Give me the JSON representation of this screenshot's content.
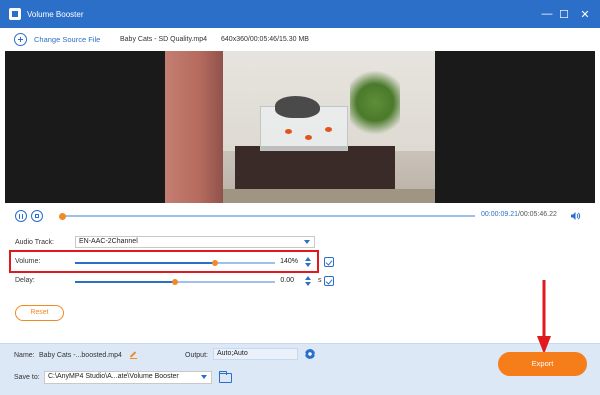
{
  "window": {
    "title": "Volume Booster",
    "minimize_glyph": "—",
    "maximize_glyph": "☐",
    "close_glyph": "✕"
  },
  "topbar": {
    "change_source_label": "Change Source File",
    "file_name": "Baby Cats - SD Quality.mp4",
    "file_meta": "640x360/00:05:46/15.30 MB"
  },
  "player": {
    "current_time": "00:00:09.21",
    "separator": "/",
    "total_time": "00:05:46.22",
    "progress_fraction": 0.0
  },
  "audio": {
    "track_label": "Audio Track:",
    "track_value": "EN-AAC-2Channel",
    "volume_label": "Volume:",
    "volume_value": "140%",
    "volume_fraction": 0.7,
    "delay_label": "Delay:",
    "delay_value": "0.00",
    "delay_unit": "s",
    "delay_fraction": 0.5
  },
  "buttons": {
    "reset": "Reset",
    "export": "Export"
  },
  "output": {
    "name_label": "Name:",
    "name_value": "Baby Cats -...boosted.mp4",
    "output_label": "Output:",
    "output_value": "Auto;Auto",
    "save_label": "Save to:",
    "save_path": "C:\\AnyMP4 Studio\\A...ate\\Volume Booster"
  },
  "colors": {
    "accent": "#2b6fc9",
    "orange": "#f08a24",
    "highlight": "#e0191f"
  },
  "icons": [
    "app-icon",
    "plus-icon",
    "pause-icon",
    "stop-icon",
    "speaker-icon",
    "copy-icon",
    "edit-icon",
    "gear-icon",
    "folder-icon"
  ]
}
